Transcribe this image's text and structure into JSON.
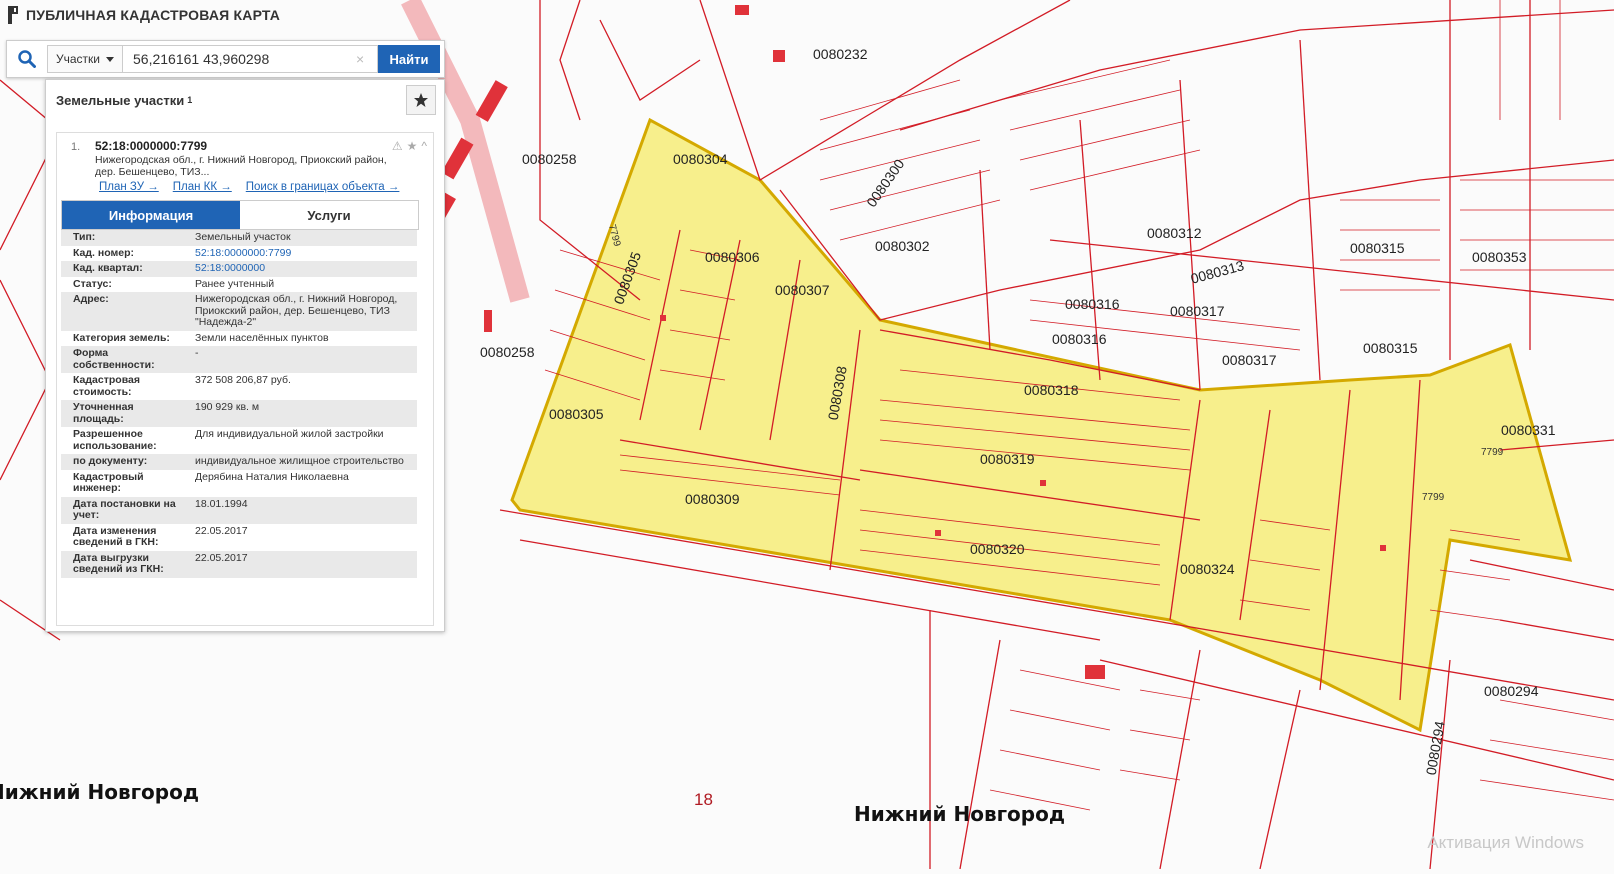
{
  "app": {
    "title": "ПУБЛИЧНАЯ КАДАСТРОВАЯ КАРТА"
  },
  "search": {
    "type_label": "Участки",
    "query": "56,216161 43,960298",
    "clear_glyph": "×",
    "button_label": "Найти"
  },
  "panel": {
    "title": "Земельные участки",
    "count": "1"
  },
  "result": {
    "index": "1.",
    "cad_number": "52:18:0000000:7799",
    "address_short": "Нижегородская обл., г. Нижний Новгород, Приокский район, дер. Бешенцево, ТИЗ...",
    "links": [
      "План ЗУ →",
      "План КК →",
      "Поиск в границах объекта →"
    ],
    "tabs": [
      "Информация",
      "Услуги"
    ],
    "info": [
      {
        "k": "Тип:",
        "v": "Земельный участок"
      },
      {
        "k": "Кад. номер:",
        "v": "52:18:0000000:7799"
      },
      {
        "k": "Кад. квартал:",
        "v": "52:18:0000000"
      },
      {
        "k": "Статус:",
        "v": "Ранее учтенный"
      },
      {
        "k": "Адрес:",
        "v": "Нижегородская обл., г. Нижний Новгород, Приокский район, дер. Бешенцево, ТИЗ \"Надежда-2\""
      },
      {
        "k": "Категория земель:",
        "v": "Земли населённых пунктов"
      },
      {
        "k": "Форма собственности:",
        "v": "-"
      },
      {
        "k": "Кадастровая стоимость:",
        "v": "372 508 206,87 руб."
      },
      {
        "k": "Уточненная площадь:",
        "v": "190 929 кв. м"
      },
      {
        "k": "Разрешенное использование:",
        "v": "Для индивидуальной жилой застройки"
      },
      {
        "k": "по документу:",
        "v": "индивидуальное жилищное строительство"
      },
      {
        "k": "Кадастровый инженер:",
        "v": "Дерябина Наталия Николаевна"
      },
      {
        "k": "Дата постановки на учет:",
        "v": "18.01.1994"
      },
      {
        "k": "Дата изменения сведений в ГКН:",
        "v": "22.05.2017"
      },
      {
        "k": "Дата выгрузки сведений из ГКН:",
        "v": "22.05.2017"
      }
    ]
  },
  "map": {
    "city_labels": [
      "Нижний Новгород",
      "Нижний Новгород"
    ],
    "number_label": "18",
    "quarters": [
      "0080258",
      "0080258",
      "0080304",
      "0080305",
      "0080306",
      "0080307",
      "0080308",
      "0080309",
      "0080305",
      "0080232",
      "0080300",
      "0080302",
      "0080312",
      "0080313",
      "0080315",
      "0080316",
      "0080316",
      "0080317",
      "0080317",
      "0080318",
      "0080319",
      "0080320",
      "0080324",
      "0080315",
      "0080331",
      "0080353",
      "0080294",
      "0080294"
    ],
    "plot_labels": [
      "7799",
      "7799",
      "7799"
    ],
    "colors": {
      "parcel_fill": "#f7ef8c",
      "border": "#d21c26",
      "highlight_border": "#d4a900",
      "accent": "#1f64b5"
    }
  },
  "watermark": "Активация Windows"
}
